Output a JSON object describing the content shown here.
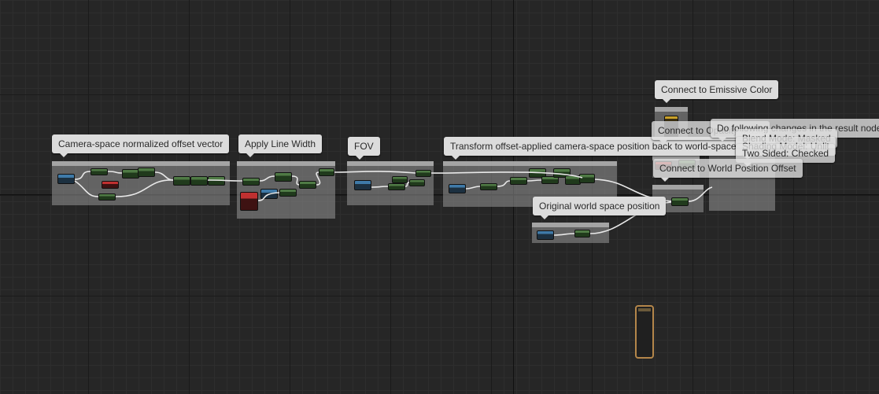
{
  "editor": {
    "comments": {
      "camera_space": "Camera-space normalized offset vector",
      "line_width": "Apply Line Width",
      "fov": "FOV",
      "transform": "Transform offset-applied camera-space position back to world-space",
      "original_world": "Original world space position",
      "emissive": "Connect to Emissive Color",
      "opacity_mask": "Connect to Opacity Mask",
      "world_offset": "Connect to World Position Offset",
      "result_changes": "Do following changes in the result node",
      "blend_mode": "Blend Mode: Masked",
      "shading_model": "Shading Model: Unlit",
      "two_sided": "Two Sided: Checked"
    }
  },
  "colors": {
    "background": "#262626",
    "comment_bubble": "#dcdcdc",
    "wire": "#e8e8e8",
    "node_green": "#4f7a45",
    "node_blue": "#3f7aa8",
    "node_red": "#c03030",
    "result_border": "#b4864a"
  },
  "icons": [
    "result-node-icon"
  ]
}
